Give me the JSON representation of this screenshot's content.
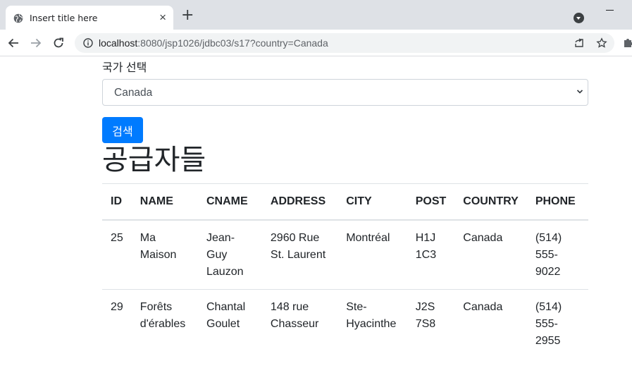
{
  "browser": {
    "tab_title": "Insert title here",
    "tab_close": "×",
    "new_tab": "+",
    "url_host": "localhost",
    "url_rest": ":8080/jsp1026/jdbc03/s17?country=Canada"
  },
  "form": {
    "label": "국가 선택",
    "selected_country": "Canada",
    "search_label": "검색"
  },
  "heading": "공급자들",
  "table": {
    "headers": [
      "ID",
      "NAME",
      "CNAME",
      "ADDRESS",
      "CITY",
      "POST",
      "COUNTRY",
      "PHONE"
    ],
    "rows": [
      [
        "25",
        "Ma Maison",
        "Jean-Guy Lauzon",
        "2960 Rue St. Laurent",
        "Montréal",
        "H1J 1C3",
        "Canada",
        "(514) 555-9022"
      ],
      [
        "29",
        "Forêts d'érables",
        "Chantal Goulet",
        "148 rue Chasseur",
        "Ste-Hyacinthe",
        "J2S 7S8",
        "Canada",
        "(514) 555-2955"
      ]
    ]
  },
  "colors": {
    "primary_button": "#007bff",
    "chrome_tabbar": "#dee1e6"
  }
}
